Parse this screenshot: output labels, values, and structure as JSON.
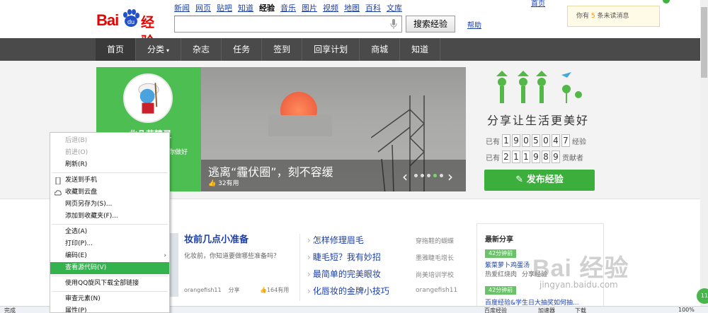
{
  "header": {
    "logo": {
      "text_red": "Bai",
      "text_paw": "du",
      "text_cn": "经验"
    },
    "nav": [
      "新闻",
      "网页",
      "贴吧",
      "知道",
      "经验",
      "音乐",
      "图片",
      "视频",
      "地图",
      "百科",
      "文库"
    ],
    "nav_active_index": 4,
    "search_value": "",
    "search_button": "搜索经验",
    "help": "帮助",
    "top_links": "首页",
    "message": {
      "pre": "你有 ",
      "count": "5",
      "post": " 条未读消息"
    }
  },
  "mainnav": {
    "items": [
      {
        "label": "首页",
        "active": true
      },
      {
        "label": "分类",
        "caret": "▾"
      },
      {
        "label": "杂志"
      },
      {
        "label": "任务"
      },
      {
        "label": "签到"
      },
      {
        "label": "回享计划"
      },
      {
        "label": "商城"
      },
      {
        "label": "知道"
      }
    ]
  },
  "user": {
    "name": "北几花精灵",
    "note": "你做好"
  },
  "slide": {
    "title": "逃离“霾伏圈”，刻不容缓",
    "likes": "32有用",
    "dot_count": 5,
    "active_dot": 3
  },
  "brand": {
    "slogan": "分享让生活更美好",
    "stat1": {
      "pre": "已有",
      "digits": [
        "1",
        "9",
        "0",
        "5",
        "0",
        "4",
        "7"
      ],
      "post": "经验"
    },
    "stat2": {
      "pre": "已有",
      "digits": [
        "2",
        "1",
        "1",
        "9",
        "8",
        "9"
      ],
      "post": "贡献者"
    },
    "publish_button": "发布经验"
  },
  "card": {
    "title": "妆前几点小准备",
    "desc": "化妆前，你知道要做哪些准备吗？",
    "author": "orangefish11",
    "share": "分享",
    "useful": "164有用"
  },
  "list": [
    {
      "title": "怎样修理眉毛",
      "author": "穿拖鞋的蝴蝶"
    },
    {
      "title": "睫毛短？我有妙招",
      "author": "墨雅睫毛增长"
    },
    {
      "title": "最简单的完美眼妆",
      "author": "尚美培训学校"
    },
    {
      "title": "化唇妆的金牌小技巧",
      "author": "orangefish11"
    }
  ],
  "recent": {
    "title": "最新分享",
    "items": [
      {
        "tag": "42分钟前",
        "link": "紫菜萝卜鸡蛋汤",
        "sub1": "热爱红烧肉",
        "sub2": "分享经验"
      },
      {
        "tag": "42分钟前",
        "link": "百度经验&学生日大抽奖如何抽...",
        "sub1": "",
        "sub2": ""
      }
    ]
  },
  "watermark": {
    "text": "Bai 经验",
    "url": "jingyan.baidu.com"
  },
  "statusbar": {
    "left": "完成",
    "items": [
      "百度经验",
      "加速器",
      "下载",
      "100%"
    ]
  },
  "float_badge": "11",
  "context_menu": {
    "items": [
      {
        "label": "后退(B)",
        "disabled": true
      },
      {
        "label": "前进(O)",
        "disabled": true
      },
      {
        "label": "刷新(R)"
      },
      {
        "sep": true
      },
      {
        "label": "发送到手机",
        "icon": "phone"
      },
      {
        "label": "收藏到云盘",
        "icon": "cloud"
      },
      {
        "label": "网页另存为(S)..."
      },
      {
        "label": "添加到收藏夹(F)..."
      },
      {
        "sep": true
      },
      {
        "label": "全选(A)"
      },
      {
        "label": "打印(P)..."
      },
      {
        "label": "编码(E)",
        "submenu": true
      },
      {
        "label": "查看源代码(V)",
        "highlight": true
      },
      {
        "sep": true
      },
      {
        "label": "使用QQ旋风下载全部链接"
      },
      {
        "sep": true
      },
      {
        "label": "审查元素(N)"
      },
      {
        "label": "属性(P)"
      }
    ]
  },
  "colors": {
    "accent": "#3cae3c",
    "brand_red": "#e10602",
    "nav_bg": "#4a4a4a",
    "link": "#1d3fa8",
    "menu_highlight": "#33b24e"
  }
}
